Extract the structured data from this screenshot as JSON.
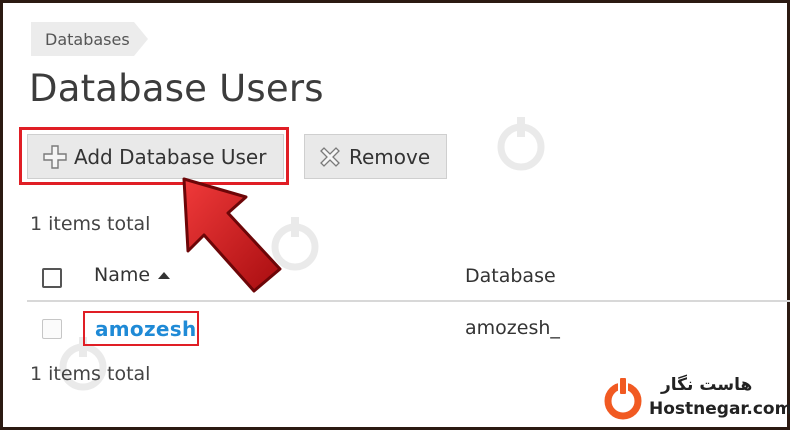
{
  "breadcrumb": {
    "label": "Databases"
  },
  "page": {
    "title": "Database Users"
  },
  "toolbar": {
    "add_label": "Add Database User",
    "add_icon": "plus-icon",
    "remove_label": "Remove",
    "remove_icon": "x-icon"
  },
  "list": {
    "items_total_top": "1 items total",
    "items_total_bottom": "1 items total",
    "columns": {
      "name": "Name",
      "database": "Database"
    },
    "sort_icon": "sort-ascending-icon",
    "rows": [
      {
        "name": "amozesh",
        "database": "amozesh_"
      }
    ]
  },
  "branding": {
    "logo_fa": "هاست نگار",
    "logo_en": "Hostnegar.com",
    "logo_color": "#f15a22"
  },
  "colors": {
    "highlight": "#e01e25",
    "link": "#1f8ad6",
    "button_bg": "#e9e9e9"
  }
}
